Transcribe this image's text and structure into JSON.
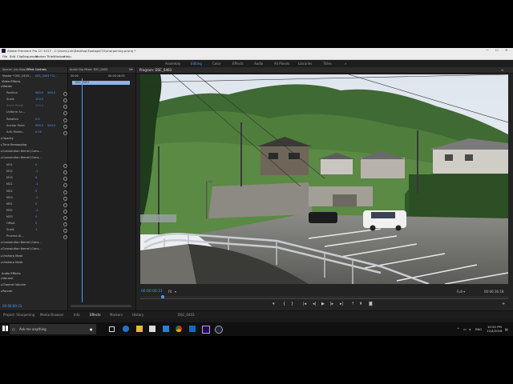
{
  "window": {
    "title": "Adobe Premiere Pro CC 2017 - C:\\Users\\Lnk\\Desktop\\Footage\\TV\\sharpening.prproj *"
  },
  "menu": {
    "items": [
      "File",
      "Edit",
      "Clip",
      "Sequence",
      "Marker",
      "Title",
      "Window",
      "Help"
    ]
  },
  "workspaces": {
    "items": [
      "Assembly",
      "Editing",
      "Color",
      "Effects",
      "Audio",
      "All Panels",
      "Libraries",
      "Titles"
    ],
    "active_index": 1
  },
  "left_panel": {
    "tabs": [
      "Source: (no clips)",
      "Effect Controls",
      "Audio Clip Mixer: DSC_0403",
      "Me"
    ],
    "master_label": "Master * DSC_0403...",
    "clip_label": "DSC_0403 * D...",
    "section_video": "Video Effects",
    "rows": [
      {
        "label": "Motion",
        "type": "section"
      },
      {
        "label": "Position",
        "v1": "960.0",
        "v2": "540.0"
      },
      {
        "label": "Scale",
        "v1": "100.0"
      },
      {
        "label": "Scale Width",
        "v1": "100.0",
        "dim": true
      },
      {
        "label": "Uniform Sc...",
        "v1": ""
      },
      {
        "label": "Rotation",
        "v1": "0.0"
      },
      {
        "label": "Anchor Point",
        "v1": "960.0",
        "v2": "540.0"
      },
      {
        "label": "Anti-flicker...",
        "v1": "0.00"
      },
      {
        "label": "Opacity",
        "type": "section"
      },
      {
        "label": "Time Remapping",
        "type": "section"
      },
      {
        "label": "Convolution Kernel (Conv...",
        "type": "section"
      },
      {
        "label": "Convolution Kernel (Conv...",
        "type": "section"
      },
      {
        "label": "M11",
        "v1": "0"
      },
      {
        "label": "M12",
        "v1": "-1"
      },
      {
        "label": "M13",
        "v1": "0"
      },
      {
        "label": "M21",
        "v1": "-1"
      },
      {
        "label": "M22",
        "v1": "5"
      },
      {
        "label": "M23",
        "v1": "-1"
      },
      {
        "label": "M31",
        "v1": "0"
      },
      {
        "label": "M32",
        "v1": "-1"
      },
      {
        "label": "M33",
        "v1": "0"
      },
      {
        "label": "Offset",
        "v1": "0"
      },
      {
        "label": "Scale",
        "v1": "1"
      },
      {
        "label": "Process Al...",
        "v1": ""
      },
      {
        "label": "Convolution Kernel (Conv...",
        "type": "section"
      },
      {
        "label": "Convolution Kernel (Conv...",
        "type": "section"
      },
      {
        "label": "Unsharp Mask",
        "type": "section"
      },
      {
        "label": "Unsharp Mask",
        "type": "section"
      }
    ],
    "section_audio": "Audio Effects",
    "audio_rows": [
      "Volume",
      "Channel Volume",
      "Panner"
    ],
    "timecode": "00:00:00:21"
  },
  "timeline_panel": {
    "start_tc": "00:00",
    "end_tc": "00:00:16:00",
    "clip_name": "DSC_0403"
  },
  "program_panel": {
    "title": "Program: DSC_0403",
    "timecode_current": "00:00:00:21",
    "fit_label": "Fit",
    "timecode_duration": "00:00:16:18",
    "playhead_fraction": 0.06
  },
  "bottom_tabs": {
    "items": [
      "Project: Sharpening",
      "Media Browser",
      "Info",
      "Effects",
      "Markers",
      "History",
      "DSC_0403"
    ],
    "active_index": 3
  },
  "taskbar": {
    "search_placeholder": "Ask me anything",
    "language": "ENG",
    "time": "10:52 PM",
    "date": "12/4/2016"
  }
}
